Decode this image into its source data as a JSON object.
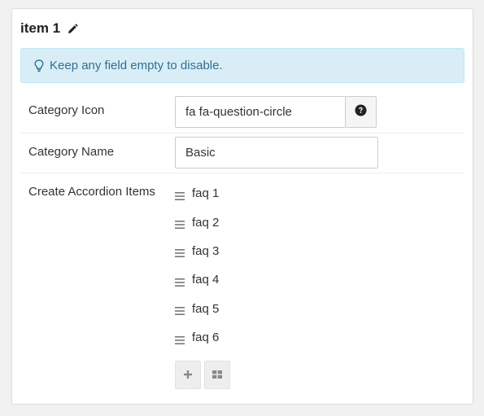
{
  "panel": {
    "title": "item 1",
    "notice": "Keep any field empty to disable."
  },
  "fields": {
    "category_icon": {
      "label": "Category Icon",
      "value": "fa fa-question-circle"
    },
    "category_name": {
      "label": "Category Name",
      "value": "Basic"
    },
    "accordion": {
      "label": "Create Accordion Items",
      "items": [
        "faq 1",
        "faq 2",
        "faq 3",
        "faq 4",
        "faq 5",
        "faq 6"
      ]
    }
  },
  "icons": {
    "title_edit": "pencil-icon",
    "notice": "lightbulb-icon",
    "icon_picker": "question-circle-icon",
    "drag_handle": "bars-icon",
    "add": "plus-icon",
    "add_multiple": "grid-icon"
  },
  "colors": {
    "notice_bg": "#d9edf7",
    "notice_text": "#31708f",
    "panel_bg": "#ffffff",
    "page_bg": "#f1f1f1"
  }
}
